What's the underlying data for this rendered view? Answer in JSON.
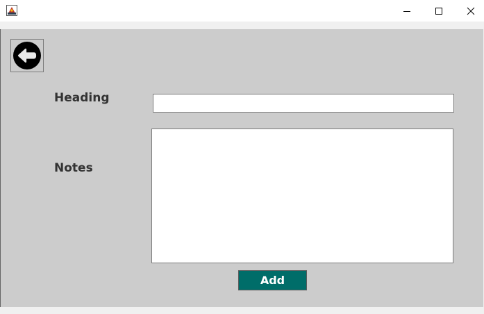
{
  "window": {
    "app_icon": "java-app-icon",
    "controls": {
      "minimize": "minimize-icon",
      "maximize": "maximize-icon",
      "close": "close-icon"
    }
  },
  "form": {
    "back_icon": "arrow-left-circle-icon",
    "heading_label": "Heading",
    "heading_value": "",
    "notes_label": "Notes",
    "notes_value": "",
    "add_label": "Add"
  },
  "colors": {
    "content_bg": "#cccccc",
    "add_button_bg": "#006d69",
    "label_text": "#333333"
  }
}
